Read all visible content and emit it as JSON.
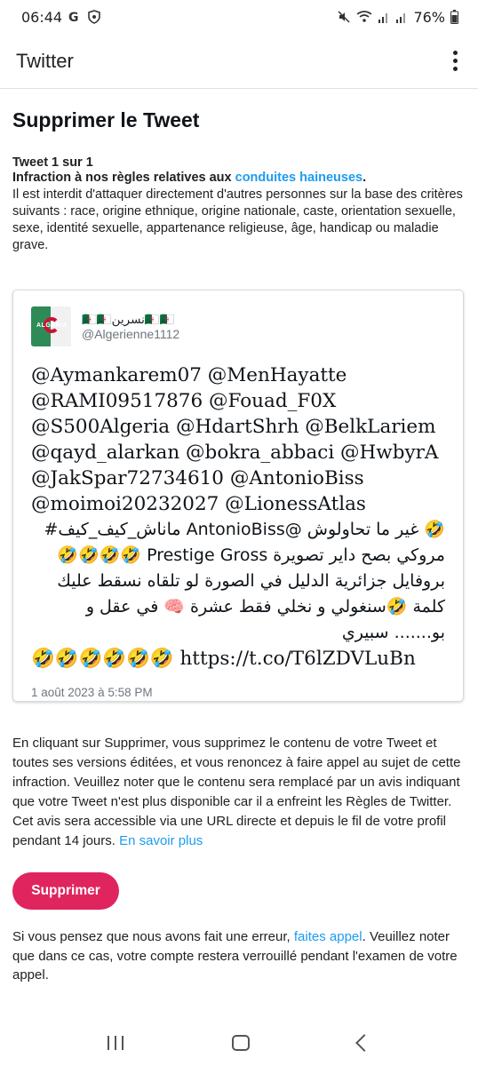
{
  "status_bar": {
    "time": "06:44",
    "battery": "76%",
    "left_icons": [
      "g-icon",
      "shield-icon"
    ],
    "right_icons": [
      "mute-icon",
      "wifi-icon",
      "signal-icon",
      "signal-icon",
      "battery-icon"
    ]
  },
  "app_bar": {
    "title": "Twitter",
    "menu_icon": "more-vert-icon"
  },
  "page": {
    "title": "Supprimer le Tweet",
    "tweet_count": "Tweet 1 sur 1",
    "infraction_prefix": "Infraction à nos règles relatives aux ",
    "infraction_link": "conduites haineuses",
    "infraction_suffix": ".",
    "rule_description": "Il est interdit d'attaquer directement d'autres personnes sur la base des critères suivants : race, origine ethnique, origine nationale, caste, orientation sexuelle, sexe, identité sexuelle, appartenance religieuse, âge, handicap ou maladie grave."
  },
  "tweet": {
    "author_name": "🇩🇿🇩🇿نسرين🇩🇿🇩🇿",
    "author_handle": "@Algerienne1112",
    "avatar_text": "ALGERIA",
    "mentions": "@Aymankarem07 @MenHayatte @RAMI09517876 @Fouad_F0X @S500Algeria @HdartShrh @BelkLariem @qayd_alarkan @bokra_abbaci @HwbyrA @JakSpar72734610 @AntonioBiss @moimoi20232027 @LionessAtlas",
    "body": "🤣 غير ما تحاولوش @AntonioBiss ماناش_كيف_كيف# مروكي بصح داير تصويرة Prestige Gross 🤣🤣🤣🤣 بروفايل جزائرية الدليل في الصورة لو تلقاه نسقط عليك كلمة 🤣سنغولي و نخلي فقط عشرة 🧠 في عقل و بو....... سبيري",
    "ending": "🤣🤣🤣🤣🤣🤣 https://t.co/T6lZDVLuBn",
    "date": "1 août 2023 à 5:58 PM"
  },
  "warning": {
    "text": "En cliquant sur Supprimer, vous supprimez le contenu de votre Tweet et toutes ses versions éditées, et vous renoncez à faire appel au sujet de cette infraction. Veuillez noter que le contenu sera remplacé par un avis indiquant que votre Tweet n'est plus disponible car il a enfreint les Règles de Twitter. Cet avis sera accessible via une URL directe et depuis le fil de votre profil pendant 14 jours. ",
    "link": "En savoir plus"
  },
  "delete_button": {
    "label": "Supprimer",
    "color": "#e0245e"
  },
  "appeal": {
    "prefix": "Si vous pensez que nous avons fait une erreur, ",
    "link": "faites appel",
    "suffix": ". Veuillez noter que dans ce cas, votre compte restera verrouillé pendant l'examen de votre appel."
  },
  "nav_bar": {
    "icons": [
      "recents-icon",
      "home-icon",
      "back-icon"
    ]
  },
  "colors": {
    "link": "#1d9bf0",
    "danger": "#e0245e"
  }
}
